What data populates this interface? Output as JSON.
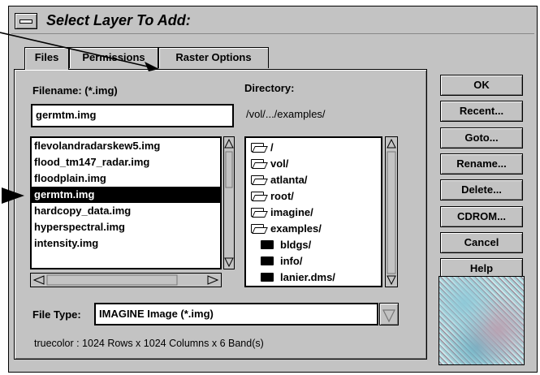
{
  "window": {
    "title": "Select Layer To Add:"
  },
  "tabs": [
    {
      "label": "Files",
      "active": true
    },
    {
      "label": "Permissions",
      "active": false
    },
    {
      "label": "Raster Options",
      "active": false
    }
  ],
  "filename": {
    "label": "Filename: (*.img)",
    "value": "germtm.img"
  },
  "directory": {
    "label": "Directory:",
    "value": "/vol/.../examples/"
  },
  "files": [
    "flevolandradarskew5.img",
    "flood_tm147_radar.img",
    "floodplain.img",
    "germtm.img",
    "hardcopy_data.img",
    "hyperspectral.img",
    "intensity.img"
  ],
  "selected_file": "germtm.img",
  "directories": [
    {
      "name": "/",
      "icon": "folder-open-icon"
    },
    {
      "name": "vol/",
      "icon": "folder-open-icon"
    },
    {
      "name": "atlanta/",
      "icon": "folder-open-icon"
    },
    {
      "name": "root/",
      "icon": "folder-open-icon"
    },
    {
      "name": "imagine/",
      "icon": "folder-open-icon"
    },
    {
      "name": "examples/",
      "icon": "folder-open-icon"
    },
    {
      "name": "bldgs/",
      "icon": "folder-closed-icon"
    },
    {
      "name": "info/",
      "icon": "folder-closed-icon"
    },
    {
      "name": "lanier.dms/",
      "icon": "folder-closed-icon"
    }
  ],
  "file_type": {
    "label": "File Type:",
    "value": "IMAGINE Image (*.img)"
  },
  "info_text": "truecolor : 1024 Rows x 1024 Columns x 6 Band(s)",
  "buttons": {
    "ok": "OK",
    "recent": "Recent...",
    "goto": "Goto...",
    "rename": "Rename...",
    "delete": "Delete...",
    "cdrom": "CDROM...",
    "cancel": "Cancel",
    "help": "Help"
  }
}
